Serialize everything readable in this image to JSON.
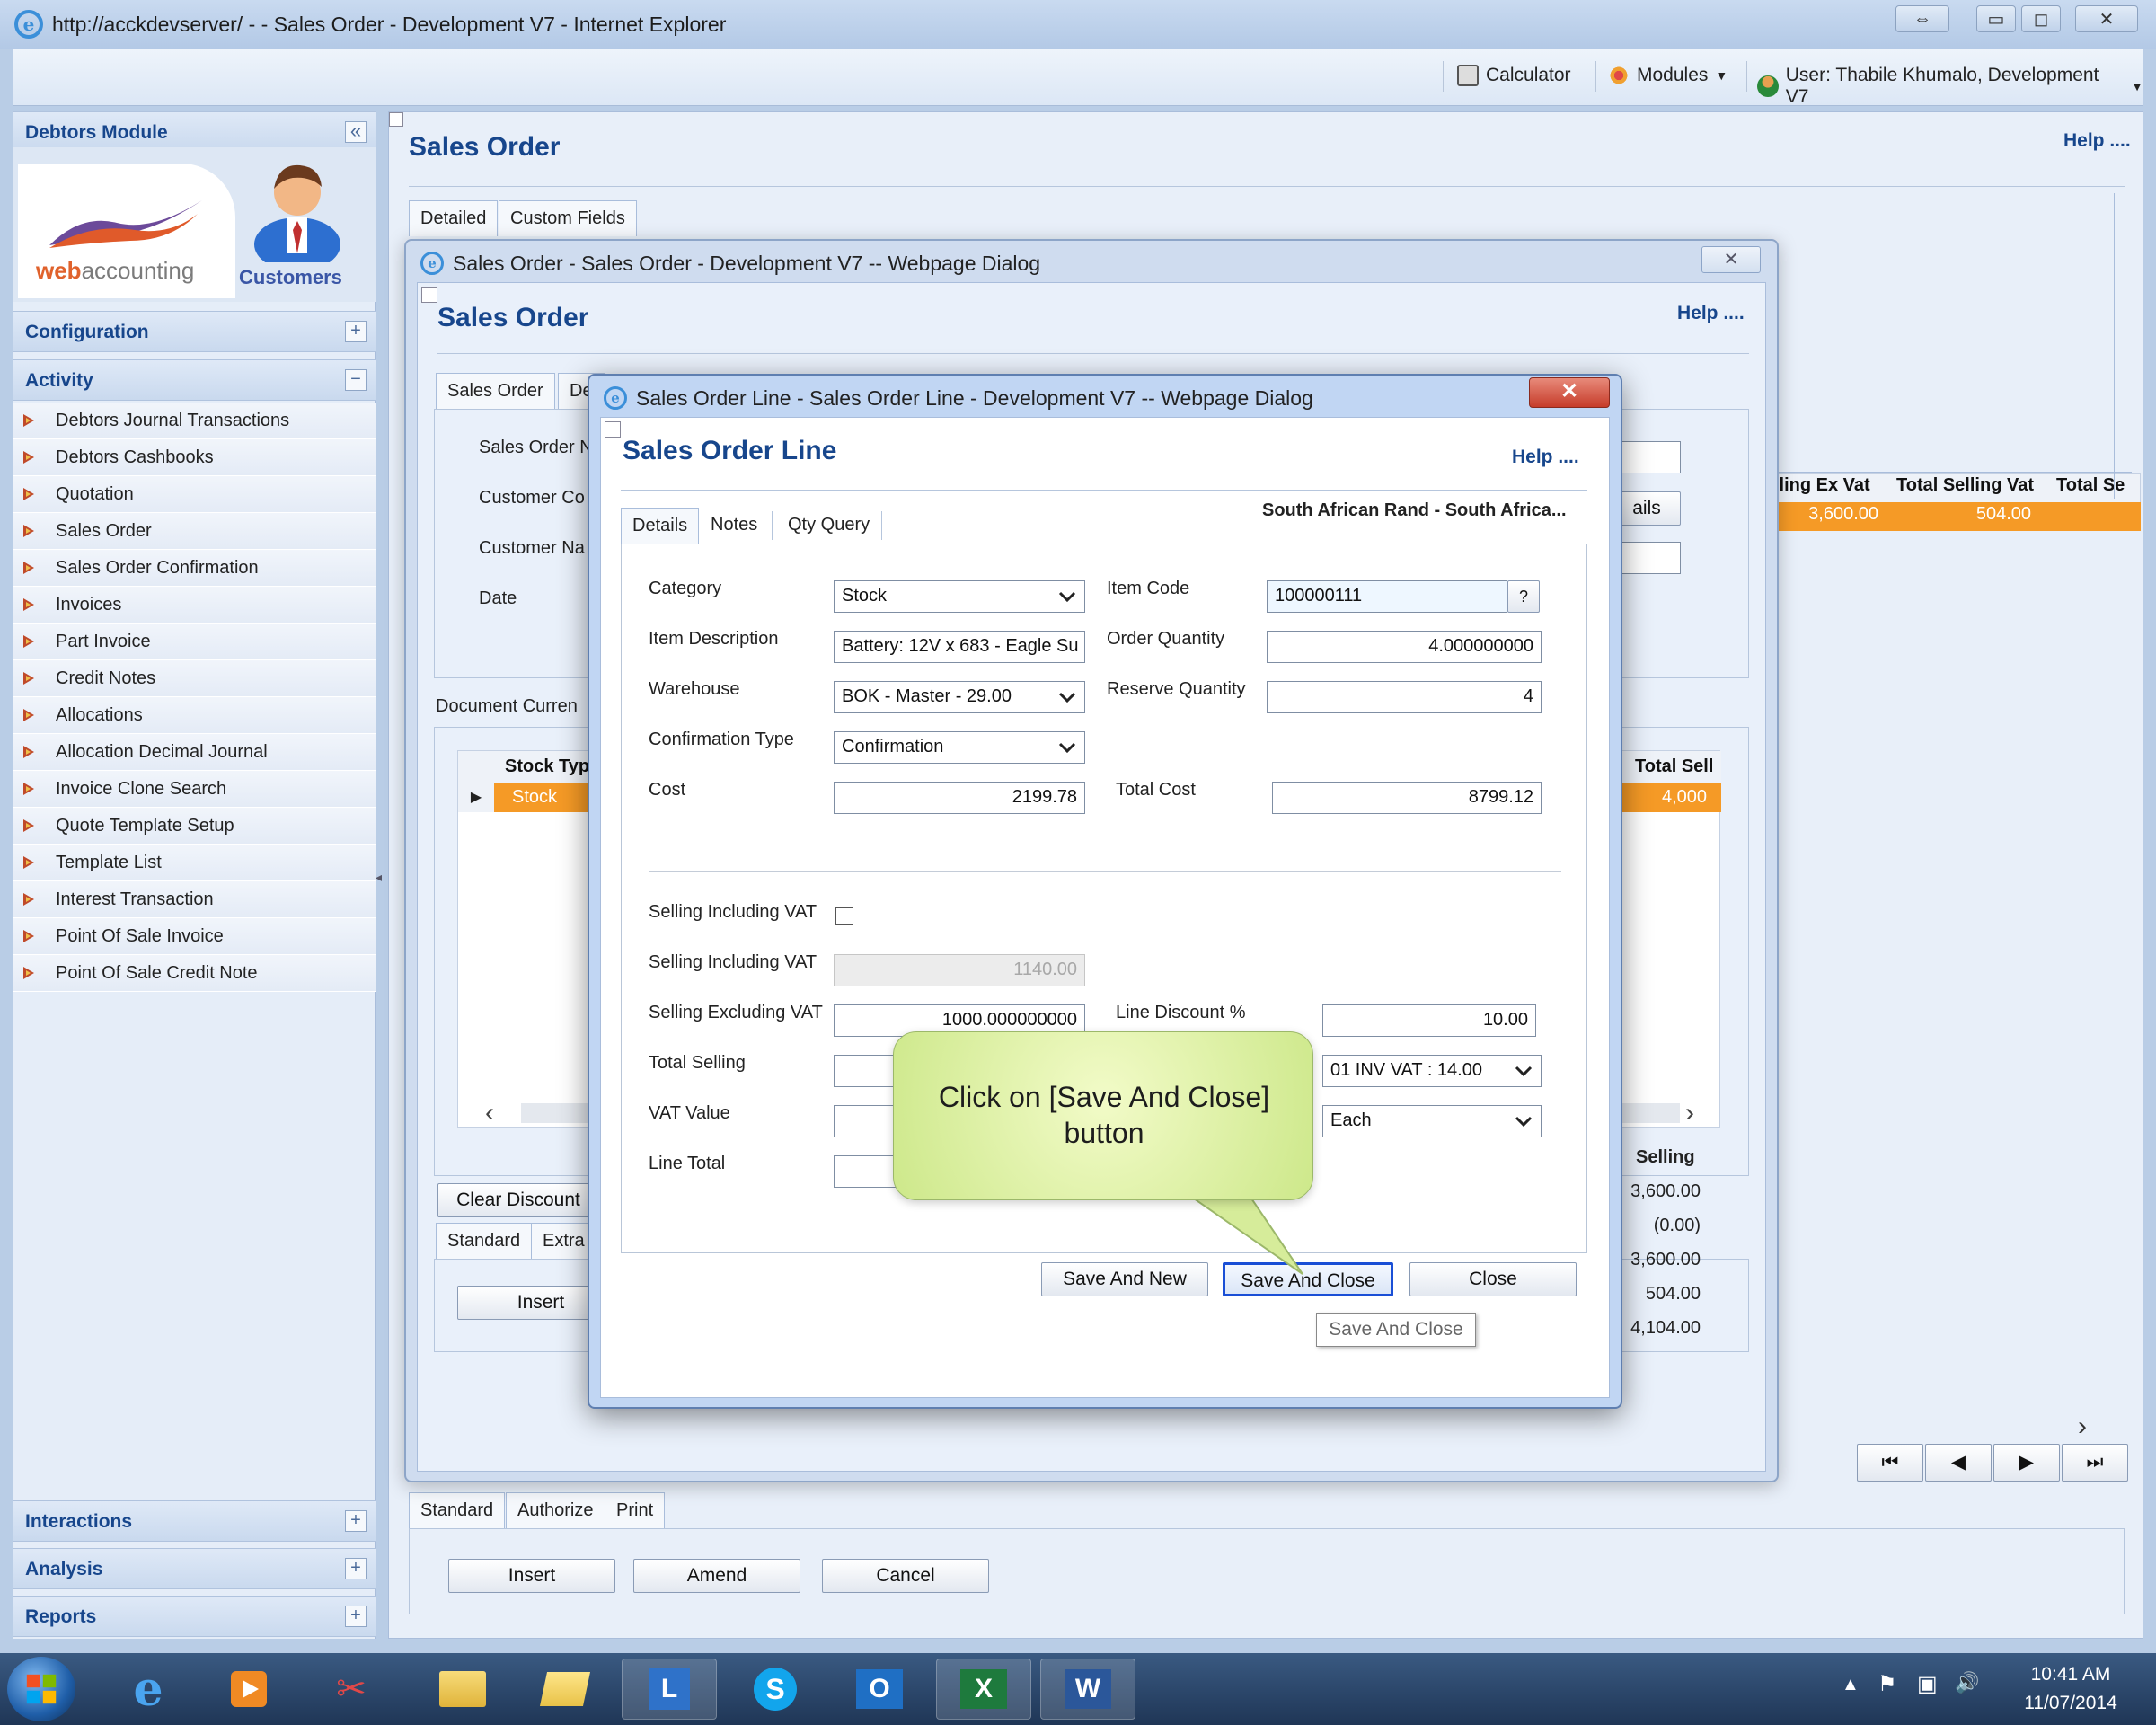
{
  "window": {
    "title": "http://acckdevserver/ -  - Sales Order - Development V7 - Internet Explorer",
    "controls": [
      "⇔",
      "▭",
      "◻",
      "✕"
    ]
  },
  "toolbar": {
    "calculator": "Calculator",
    "modules": "Modules",
    "user": "User: Thabile Khumalo, Development V7"
  },
  "sidebar": {
    "module_title": "Debtors Module",
    "collapse_glyph": "«",
    "logo_text_brand": "web",
    "logo_text_rest": "accounting",
    "customers_label": "Customers",
    "sections": {
      "configuration": "Configuration",
      "activity": "Activity",
      "interactions": "Interactions",
      "analysis": "Analysis",
      "reports": "Reports"
    },
    "plus": "+",
    "minus": "−",
    "items": [
      "Debtors Journal Transactions",
      "Debtors Cashbooks",
      "Quotation",
      "Sales Order",
      "Sales Order Confirmation",
      "Invoices",
      "Part Invoice",
      "Credit Notes",
      "Allocations",
      "Allocation Decimal Journal",
      "Invoice Clone Search",
      "Quote Template Setup",
      "Template List",
      "Interest Transaction",
      "Point Of Sale Invoice",
      "Point Of Sale Credit Note"
    ]
  },
  "main": {
    "title": "Sales Order",
    "help": "Help ....",
    "tabs": [
      "Detailed",
      "Custom Fields"
    ],
    "grid_headers": [
      "lling Ex Vat",
      "Total Selling Vat",
      "Total Se"
    ],
    "grid_values": [
      "3,600.00",
      "504.00"
    ],
    "bottom_tabs": [
      "Standard",
      "Authorize",
      "Print"
    ],
    "buttons": {
      "insert": "Insert",
      "amend": "Amend",
      "cancel": "Cancel"
    },
    "pager": [
      "⏮",
      "◀",
      "▶",
      "⏭"
    ],
    "scroll_right": "›"
  },
  "dialog1": {
    "title": "Sales Order - Sales Order - Development V7 -- Webpage Dialog",
    "close": "✕",
    "heading": "Sales Order",
    "help": "Help ....",
    "tabs": [
      "Sales Order",
      "De"
    ],
    "labels": [
      "Sales Order N",
      "Customer Co",
      "Customer Na",
      "Date"
    ],
    "details_btn": "ails",
    "doc_currency": "Document Curren",
    "grid_headers": {
      "stock_type": "Stock Typ",
      "total_sell": "Total Sell"
    },
    "grid_row": {
      "marker": "▶",
      "stock_type": "Stock",
      "total_sell": "4,000"
    },
    "clear_discount": "Clear Discount",
    "tabs2": [
      "Standard",
      "Extra"
    ],
    "insert": "Insert",
    "selling_header": "Selling",
    "selling_values": [
      "3,600.00",
      "(0.00)",
      "3,600.00",
      "504.00",
      "4,104.00"
    ],
    "scroll_left": "‹",
    "scroll_right": "›"
  },
  "dialog2": {
    "title": "Sales Order Line - Sales Order Line - Development V7 -- Webpage Dialog",
    "close": "✕",
    "heading": "Sales Order Line",
    "help": "Help ....",
    "tabs": [
      "Details",
      "Notes",
      "Qty Query"
    ],
    "currency": "South African Rand - South Africa...",
    "fields": {
      "category": {
        "label": "Category",
        "value": "Stock"
      },
      "item_code": {
        "label": "Item Code",
        "value": "100000111",
        "lookup": "?"
      },
      "item_description": {
        "label": "Item Description",
        "value": "Battery: 12V x 683 - Eagle Su"
      },
      "order_quantity": {
        "label": "Order Quantity",
        "value": "4.000000000"
      },
      "warehouse": {
        "label": "Warehouse",
        "value": "BOK - Master - 29.00"
      },
      "reserve_quantity": {
        "label": "Reserve Quantity",
        "value": "4"
      },
      "confirmation_type": {
        "label": "Confirmation Type",
        "value": "Confirmation"
      },
      "cost": {
        "label": "Cost",
        "value": "2199.78"
      },
      "total_cost": {
        "label": "Total Cost",
        "value": "8799.12"
      },
      "selling_incl_vat_check": {
        "label": "Selling Including VAT",
        "checked": false
      },
      "selling_incl_vat": {
        "label": "Selling Including VAT",
        "value": "1140.00"
      },
      "selling_excl_vat": {
        "label": "Selling Excluding VAT",
        "value": "1000.000000000"
      },
      "line_discount": {
        "label": "Line Discount %",
        "value": "10.00"
      },
      "total_selling": {
        "label": "Total Selling",
        "value": ""
      },
      "vat_code": {
        "value": "01 INV VAT : 14.00"
      },
      "vat_value": {
        "label": "VAT Value",
        "value": ""
      },
      "unit": {
        "value": "Each"
      },
      "line_total": {
        "label": "Line Total",
        "value": ""
      }
    },
    "buttons": {
      "save_and_new": "Save And New",
      "save_and_close": "Save And Close",
      "close": "Close"
    },
    "tooltip": "Save And Close"
  },
  "callout": {
    "text": "Click on [Save And Close] button"
  },
  "taskbar": {
    "time": "10:41 AM",
    "date": "11/07/2014",
    "tray": [
      "▲",
      "⚑",
      "▣",
      "🔊"
    ],
    "apps": [
      "start",
      "internet-explorer",
      "media-player",
      "snipping-tool",
      "file-explorer",
      "folder",
      "lync",
      "skype",
      "outlook",
      "excel",
      "word"
    ],
    "labels": {
      "ie": "e",
      "lync": "L",
      "skype": "S",
      "outlook": "O",
      "excel": "X",
      "word": "W"
    }
  }
}
